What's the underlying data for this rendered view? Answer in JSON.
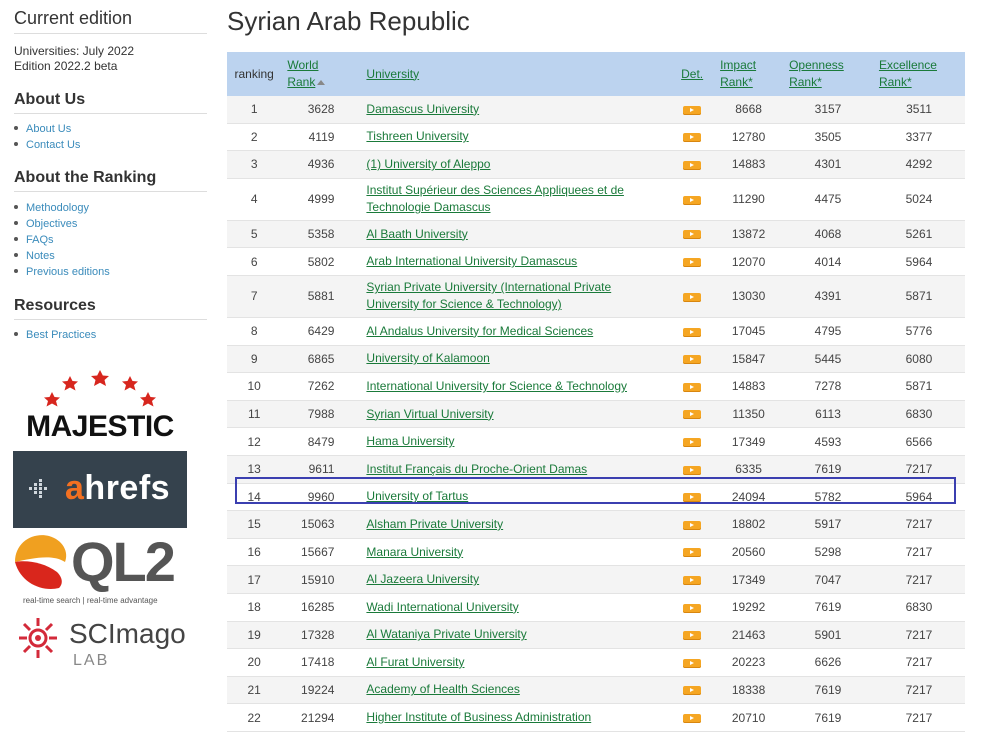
{
  "sidebar": {
    "edition_title": "Current edition",
    "edition_lines": [
      "Universities: July 2022",
      "Edition 2022.2 beta"
    ],
    "about_us": {
      "heading": "About Us",
      "items": [
        "About Us",
        "Contact Us"
      ]
    },
    "about_ranking": {
      "heading": "About the Ranking",
      "items": [
        "Methodology",
        "Objectives",
        "FAQs",
        "Notes",
        "Previous editions"
      ]
    },
    "resources": {
      "heading": "Resources",
      "items": [
        "Best Practices"
      ]
    }
  },
  "logos": {
    "majestic": "MAJESTIC",
    "ahrefs_a": "a",
    "ahrefs_rest": "hrefs",
    "ql2": "QL2",
    "ql2_tagline": "real-time search | real-time advantage",
    "scimago": "SCImago",
    "scimago_lab": "LAB"
  },
  "page_title": "Syrian Arab Republic",
  "table": {
    "headers": {
      "ranking": "ranking",
      "world_rank_1": "World",
      "world_rank_2": "Rank",
      "university": "University",
      "det": "Det.",
      "impact_1": "Impact",
      "impact_2": "Rank*",
      "openness_1": "Openness",
      "openness_2": "Rank*",
      "excellence_1": "Excellence",
      "excellence_2": "Rank*"
    },
    "rows": [
      {
        "rank": "1",
        "world": "3628",
        "uni": "Damascus University",
        "impact": "8668",
        "openness": "3157",
        "excellence": "3511"
      },
      {
        "rank": "2",
        "world": "4119",
        "uni": "Tishreen University",
        "impact": "12780",
        "openness": "3505",
        "excellence": "3377"
      },
      {
        "rank": "3",
        "world": "4936",
        "uni": "(1) University of Aleppo",
        "impact": "14883",
        "openness": "4301",
        "excellence": "4292"
      },
      {
        "rank": "4",
        "world": "4999",
        "uni": "Institut Supérieur des Sciences Appliquees et de Technologie Damascus",
        "impact": "11290",
        "openness": "4475",
        "excellence": "5024"
      },
      {
        "rank": "5",
        "world": "5358",
        "uni": "Al Baath University",
        "impact": "13872",
        "openness": "4068",
        "excellence": "5261"
      },
      {
        "rank": "6",
        "world": "5802",
        "uni": "Arab International University Damascus",
        "impact": "12070",
        "openness": "4014",
        "excellence": "5964"
      },
      {
        "rank": "7",
        "world": "5881",
        "uni": "Syrian Private University (International Private University for Science & Technology)",
        "impact": "13030",
        "openness": "4391",
        "excellence": "5871"
      },
      {
        "rank": "8",
        "world": "6429",
        "uni": "Al Andalus University for Medical Sciences",
        "impact": "17045",
        "openness": "4795",
        "excellence": "5776"
      },
      {
        "rank": "9",
        "world": "6865",
        "uni": "University of Kalamoon",
        "impact": "15847",
        "openness": "5445",
        "excellence": "6080"
      },
      {
        "rank": "10",
        "world": "7262",
        "uni": "International University for Science & Technology",
        "impact": "14883",
        "openness": "7278",
        "excellence": "5871"
      },
      {
        "rank": "11",
        "world": "7988",
        "uni": "Syrian Virtual University",
        "impact": "11350",
        "openness": "6113",
        "excellence": "6830"
      },
      {
        "rank": "12",
        "world": "8479",
        "uni": "Hama University",
        "impact": "17349",
        "openness": "4593",
        "excellence": "6566"
      },
      {
        "rank": "13",
        "world": "9611",
        "uni": "Institut Français du Proche-Orient Damas",
        "impact": "6335",
        "openness": "7619",
        "excellence": "7217"
      },
      {
        "rank": "14",
        "world": "9960",
        "uni": "University of Tartus",
        "impact": "24094",
        "openness": "5782",
        "excellence": "5964"
      },
      {
        "rank": "15",
        "world": "15063",
        "uni": "Alsham Private University",
        "impact": "18802",
        "openness": "5917",
        "excellence": "7217"
      },
      {
        "rank": "16",
        "world": "15667",
        "uni": "Manara University",
        "impact": "20560",
        "openness": "5298",
        "excellence": "7217"
      },
      {
        "rank": "17",
        "world": "15910",
        "uni": "Al Jazeera University",
        "impact": "17349",
        "openness": "7047",
        "excellence": "7217"
      },
      {
        "rank": "18",
        "world": "16285",
        "uni": "Wadi International University",
        "impact": "19292",
        "openness": "7619",
        "excellence": "6830"
      },
      {
        "rank": "19",
        "world": "17328",
        "uni": "Al Wataniya Private University",
        "impact": "21463",
        "openness": "5901",
        "excellence": "7217"
      },
      {
        "rank": "20",
        "world": "17418",
        "uni": "Al Furat University",
        "impact": "20223",
        "openness": "6626",
        "excellence": "7217"
      },
      {
        "rank": "21",
        "world": "19224",
        "uni": "Academy of Health Sciences",
        "impact": "18338",
        "openness": "7619",
        "excellence": "7217"
      },
      {
        "rank": "22",
        "world": "21294",
        "uni": "Higher Institute of Business Administration",
        "impact": "20710",
        "openness": "7619",
        "excellence": "7217"
      }
    ]
  },
  "colors": {
    "header_bg": "#bcd3ef",
    "link_green": "#1a7a3a",
    "det_orange": "#f5a623",
    "highlight_border": "#3b3fb0"
  }
}
